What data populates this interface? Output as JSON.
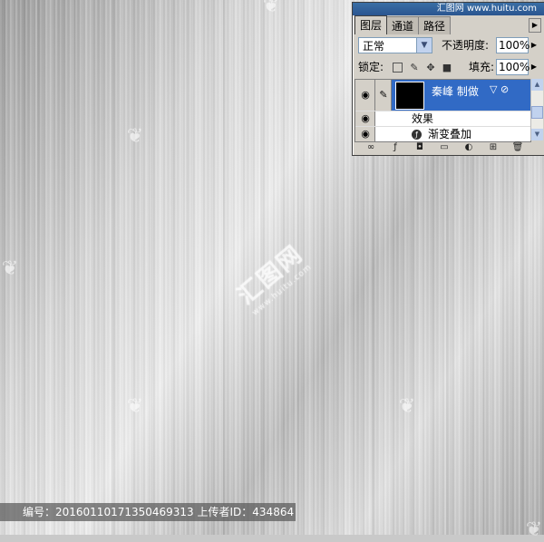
{
  "panel": {
    "site_mark": "汇图网 www.huitu.com",
    "tabs": [
      "图层",
      "通道",
      "路径"
    ],
    "blend_mode": "正常",
    "opacity_label": "不透明度:",
    "opacity_value": "100%",
    "lock_label": "锁定:",
    "fill_label": "填充:",
    "fill_value": "100%",
    "layer_name": "秦峰 制做",
    "effects_label": "效果",
    "effect_item": "渐变叠加"
  },
  "footer": {
    "text": "编号：20160110171350469313 上传者ID：434864"
  },
  "colors": {
    "selection": "#316ac5",
    "panel_bg": "#d4d0c8"
  }
}
